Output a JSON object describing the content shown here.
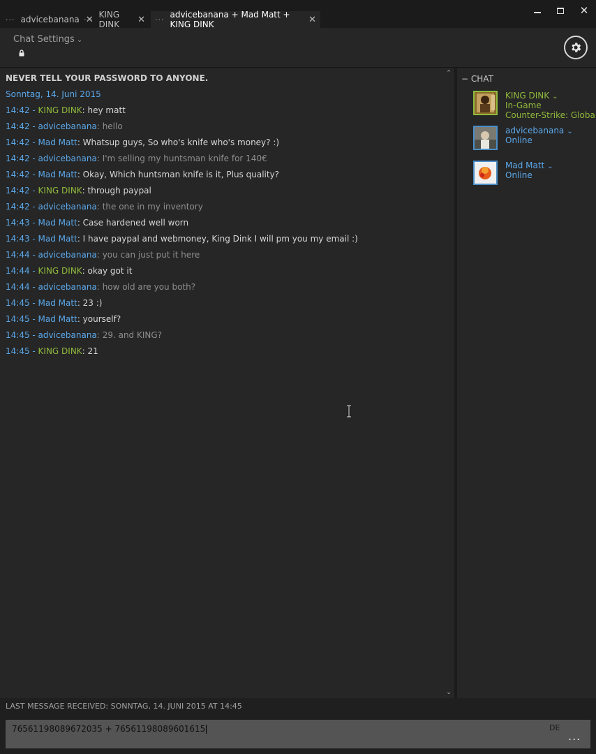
{
  "tabs": [
    {
      "label": "advicebanana",
      "active": false
    },
    {
      "label": "KING DINK",
      "active": false
    },
    {
      "label": "advicebanana + Mad Matt + KING DINK",
      "active": true
    }
  ],
  "header": {
    "chat_settings_label": "Chat Settings"
  },
  "chat": {
    "warning": "NEVER TELL YOUR PASSWORD TO ANYONE.",
    "date": "Sonntag, 14. Juni 2015",
    "messages": [
      {
        "time": "14:42 - ",
        "name": "KING DINK",
        "sep": ": ",
        "text": "hey matt"
      },
      {
        "time": "14:42 - ",
        "name": "advicebanana",
        "sep": ": ",
        "text": "hello"
      },
      {
        "time": "14:42 - ",
        "name": "Mad Matt",
        "sep": ": ",
        "text": "Whatsup guys, So who's knife who's money? :)"
      },
      {
        "time": "14:42 - ",
        "name": "advicebanana",
        "sep": ": ",
        "text": "I'm selling my huntsman knife for 140€"
      },
      {
        "time": "14:42 - ",
        "name": "Mad Matt",
        "sep": ": ",
        "text": "Okay, Which huntsman knife is it, Plus quality?"
      },
      {
        "time": "14:42 - ",
        "name": "KING DINK",
        "sep": ": ",
        "text": "through paypal"
      },
      {
        "time": "14:42 - ",
        "name": "advicebanana",
        "sep": ": ",
        "text": "the one in my inventory"
      },
      {
        "time": "14:43 - ",
        "name": "Mad Matt",
        "sep": ": ",
        "text": "Case hardened well worn"
      },
      {
        "time": "14:43 - ",
        "name": "Mad Matt",
        "sep": ": ",
        "text": "I have paypal and webmoney, King Dink I will pm you my email :)"
      },
      {
        "time": "14:44 - ",
        "name": "advicebanana",
        "sep": ": ",
        "text": "you can just put it here"
      },
      {
        "time": "14:44 - ",
        "name": "KING DINK",
        "sep": ": ",
        "text": "okay got it"
      },
      {
        "time": "14:44 - ",
        "name": "advicebanana",
        "sep": ": ",
        "text": "how old are you both?"
      },
      {
        "time": "14:45 - ",
        "name": "Mad Matt",
        "sep": ": ",
        "text": "23 :)"
      },
      {
        "time": "14:45 - ",
        "name": "Mad Matt",
        "sep": ": ",
        "text": "yourself?"
      },
      {
        "time": "14:45 - ",
        "name": "advicebanana",
        "sep": ": ",
        "text": "29. and KING?"
      },
      {
        "time": "14:45 - ",
        "name": "KING DINK",
        "sep": ": ",
        "text": "21"
      }
    ]
  },
  "friends": {
    "header": "CHAT",
    "items": [
      {
        "name": "KING DINK",
        "status": "In-Game",
        "game": "Counter-Strike: Global"
      },
      {
        "name": "advicebanana",
        "status": "Online"
      },
      {
        "name": "Mad Matt",
        "status": "Online"
      }
    ]
  },
  "footer": {
    "last_message": "LAST MESSAGE RECEIVED: SONNTAG, 14. JUNI 2015 AT 14:45",
    "input_value": "76561198089672035 + 76561198089601615",
    "lang": "DE",
    "more": "..."
  },
  "colors": {
    "name_green": "#90ba3c",
    "name_blue": "#5ba8ea",
    "background": "#262626"
  }
}
